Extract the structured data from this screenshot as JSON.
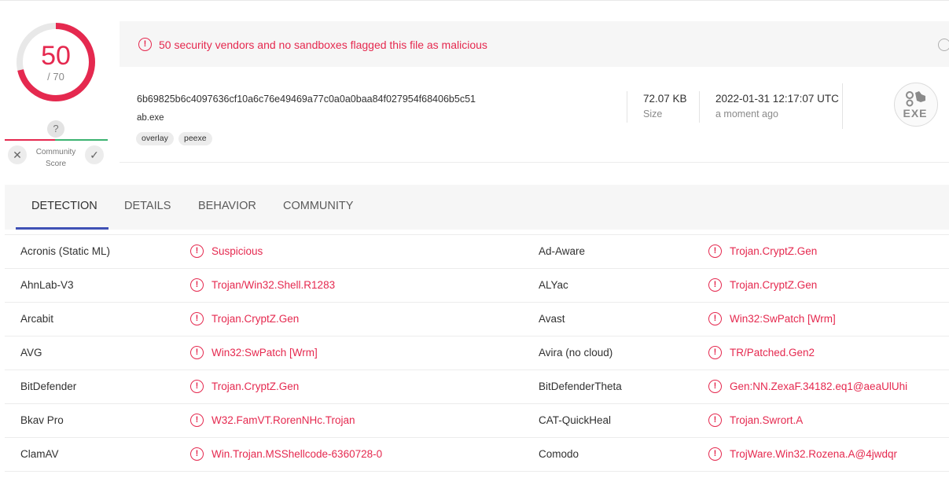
{
  "score": {
    "positives": "50",
    "total": "/ 70",
    "fraction": 0.714
  },
  "community": {
    "question": "?",
    "label_line1": "Community",
    "label_line2": "Score",
    "vote_down": "✕",
    "vote_up": "✓"
  },
  "alert": {
    "icon": "!",
    "text": "50 security vendors and no sandboxes flagged this file as malicious"
  },
  "file": {
    "hash": "6b69825b6c4097636cf10a6c76e49469a77c0a0a0baa84f027954f68406b5c51",
    "name": "ab.exe",
    "tags": [
      "overlay",
      "peexe"
    ],
    "size": "72.07 KB",
    "size_label": "Size",
    "date": "2022-01-31 12:17:07 UTC",
    "date_label": "a moment ago",
    "type_badge": "EXE"
  },
  "tabs": [
    "DETECTION",
    "DETAILS",
    "BEHAVIOR",
    "COMMUNITY"
  ],
  "active_tab": 0,
  "detections": [
    {
      "left_vendor": "Acronis (Static ML)",
      "left_result": "Suspicious",
      "right_vendor": "Ad-Aware",
      "right_result": "Trojan.CryptZ.Gen"
    },
    {
      "left_vendor": "AhnLab-V3",
      "left_result": "Trojan/Win32.Shell.R1283",
      "right_vendor": "ALYac",
      "right_result": "Trojan.CryptZ.Gen"
    },
    {
      "left_vendor": "Arcabit",
      "left_result": "Trojan.CryptZ.Gen",
      "right_vendor": "Avast",
      "right_result": "Win32:SwPatch [Wrm]"
    },
    {
      "left_vendor": "AVG",
      "left_result": "Win32:SwPatch [Wrm]",
      "right_vendor": "Avira (no cloud)",
      "right_result": "TR/Patched.Gen2"
    },
    {
      "left_vendor": "BitDefender",
      "left_result": "Trojan.CryptZ.Gen",
      "right_vendor": "BitDefenderTheta",
      "right_result": "Gen:NN.ZexaF.34182.eq1@aeaUlUhi"
    },
    {
      "left_vendor": "Bkav Pro",
      "left_result": "W32.FamVT.RorenNHc.Trojan",
      "right_vendor": "CAT-QuickHeal",
      "right_result": "Trojan.Swrort.A"
    },
    {
      "left_vendor": "ClamAV",
      "left_result": "Win.Trojan.MSShellcode-6360728-0",
      "right_vendor": "Comodo",
      "right_result": "TrojWare.Win32.Rozena.A@4jwdqr"
    }
  ],
  "colors": {
    "malicious": "#e5294f",
    "tab_accent": "#3f51b5",
    "harmless": "#3cb371"
  },
  "icons": {
    "alert": "alert-circle-icon",
    "detection": "alert-circle-icon",
    "file_type": "exe-file-icon",
    "refresh": "refresh-icon"
  }
}
